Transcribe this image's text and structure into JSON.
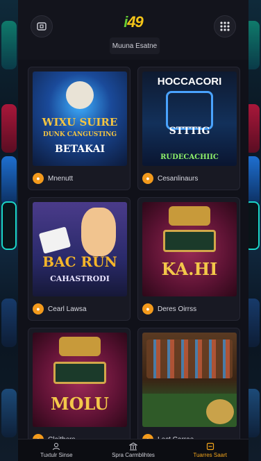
{
  "header": {
    "logo_main": "i",
    "logo_number": "49",
    "subtitle": "Muuna Esatne"
  },
  "cards": [
    {
      "title": "Mnenutt",
      "art_line1": "WIXU SUIRE",
      "art_line2": "DUNK CANGUSTING",
      "art_line3": "BETAKAI"
    },
    {
      "title": "Cesanlinaurs",
      "art_line1": "HOCCACORI",
      "art_line2": "STTTIG",
      "art_line3": "RUDECACHIIC"
    },
    {
      "title": "Cearl Lawsa",
      "art_line1": "BAC RUN",
      "art_line2": "CAHASTRODI",
      "art_line3": ""
    },
    {
      "title": "Deres Oirrss",
      "art_line1": "KA.HI",
      "art_line2": "",
      "art_line3": ""
    },
    {
      "title": "Claitbers",
      "art_line1": "MOLU",
      "art_line2": "",
      "art_line3": ""
    },
    {
      "title": "Lect Carrae",
      "art_line1": "",
      "art_line2": "",
      "art_line3": ""
    }
  ],
  "nav": [
    {
      "label": "Tuxtulr Sinse",
      "icon": "user-icon"
    },
    {
      "label": "Spra Carmblihtes",
      "icon": "bank-icon"
    },
    {
      "label": "Tuarres Saart",
      "icon": "ticket-icon",
      "active": true
    }
  ],
  "colors": {
    "accent": "#f39a1c",
    "background": "#101119",
    "card": "#181923"
  }
}
